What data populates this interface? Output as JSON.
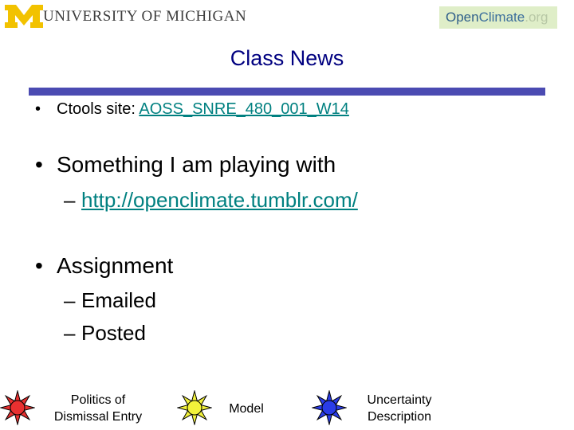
{
  "header": {
    "university_logo": "UNIVERSITY OF MICHIGAN",
    "openclimate_logo": {
      "part1": "Open",
      "part2": "Climate",
      "part3": ".org"
    }
  },
  "title": "Class News",
  "bullets": {
    "ctools": {
      "label": "Ctools site: ",
      "link": "AOSS_SNRE_480_001_W14"
    },
    "playing": {
      "label": "Something I am playing with",
      "dash": "–",
      "link": "http://openclimate.tumblr.com/"
    },
    "assignment": {
      "label": "Assignment",
      "dash": "–",
      "items": [
        "Emailed",
        "Posted"
      ]
    }
  },
  "diagram": {
    "items": [
      {
        "icon": "red-star-icon",
        "color": "#e83030",
        "label_line1": "Politics of",
        "label_line2": "Dismissal Entry"
      },
      {
        "icon": "yellow-star-icon",
        "color": "#f2f23a",
        "label_line1": "Model",
        "label_line2": ""
      },
      {
        "icon": "blue-star-icon",
        "color": "#2a3ce8",
        "label_line1": "Uncertainty",
        "label_line2": "Description"
      }
    ]
  },
  "colors": {
    "title": "#000080",
    "rule": "#4b4bb2",
    "link": "#008080"
  }
}
